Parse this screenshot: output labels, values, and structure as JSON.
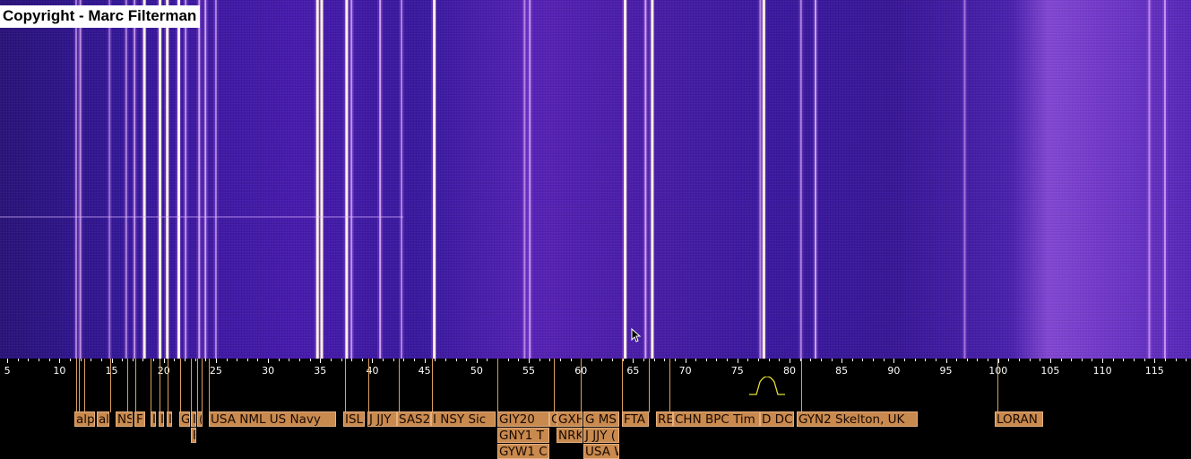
{
  "watermark": {
    "text": "Copyright - Marc Filterman"
  },
  "colors": {
    "background": "#000000",
    "label_bg": "#c98a4f",
    "label_text": "#1a0a00",
    "axis_text": "#ffffff",
    "filter_shape": "#e8e030"
  },
  "frequency_axis": {
    "unit": "kHz",
    "range": [
      4.3,
      118.5
    ],
    "major_ticks": [
      5,
      10,
      15,
      20,
      25,
      30,
      35,
      40,
      45,
      50,
      55,
      60,
      65,
      70,
      75,
      80,
      85,
      90,
      95,
      100,
      105,
      110,
      115
    ]
  },
  "signal_lines": [
    {
      "freq": 11.6,
      "brightness": 0.6
    },
    {
      "freq": 12.0,
      "brightness": 0.7
    },
    {
      "freq": 14.8,
      "brightness": 0.5
    },
    {
      "freq": 16.4,
      "brightness": 0.6
    },
    {
      "freq": 17.2,
      "brightness": 0.7
    },
    {
      "freq": 18.1,
      "brightness": 0.9
    },
    {
      "freq": 19.6,
      "brightness": 1.0
    },
    {
      "freq": 20.3,
      "brightness": 1.0
    },
    {
      "freq": 21.4,
      "brightness": 0.9
    },
    {
      "freq": 22.1,
      "brightness": 0.7
    },
    {
      "freq": 23.4,
      "brightness": 0.8
    },
    {
      "freq": 24.0,
      "brightness": 0.8
    },
    {
      "freq": 25.0,
      "brightness": 0.6
    },
    {
      "freq": 34.7,
      "brightness": 0.9
    },
    {
      "freq": 35.1,
      "brightness": 0.9
    },
    {
      "freq": 37.5,
      "brightness": 0.9
    },
    {
      "freq": 38.0,
      "brightness": 0.7
    },
    {
      "freq": 40.75,
      "brightness": 0.8
    },
    {
      "freq": 42.8,
      "brightness": 0.6
    },
    {
      "freq": 45.9,
      "brightness": 0.9
    },
    {
      "freq": 54.6,
      "brightness": 0.6
    },
    {
      "freq": 55.1,
      "brightness": 0.7
    },
    {
      "freq": 64.2,
      "brightness": 1.0
    },
    {
      "freq": 66.2,
      "brightness": 0.8
    },
    {
      "freq": 66.8,
      "brightness": 0.9
    },
    {
      "freq": 77.2,
      "brightness": 0.6
    },
    {
      "freq": 77.5,
      "brightness": 1.0
    },
    {
      "freq": 81.1,
      "brightness": 0.6
    },
    {
      "freq": 82.5,
      "brightness": 0.8
    },
    {
      "freq": 96.8,
      "brightness": 0.5
    },
    {
      "freq": 114.5,
      "brightness": 0.6
    },
    {
      "freq": 116.0,
      "brightness": 0.7
    }
  ],
  "stations": [
    {
      "label": "alp",
      "freq_left": 11.4,
      "width_khz": 2.0,
      "row": 0
    },
    {
      "label": "al",
      "freq_left": 13.6,
      "width_khz": 1.2,
      "row": 0
    },
    {
      "label": "NS",
      "freq_left": 15.4,
      "width_khz": 1.6,
      "row": 0
    },
    {
      "label": "F",
      "freq_left": 17.2,
      "width_khz": 1.0,
      "row": 0
    },
    {
      "label": "I",
      "freq_left": 18.7,
      "width_khz": 0.5,
      "row": 0
    },
    {
      "label": "I",
      "freq_left": 19.5,
      "width_khz": 0.5,
      "row": 0
    },
    {
      "label": "I",
      "freq_left": 20.3,
      "width_khz": 0.5,
      "row": 0
    },
    {
      "label": "G",
      "freq_left": 21.5,
      "width_khz": 1.0,
      "row": 0
    },
    {
      "label": "I",
      "freq_left": 22.6,
      "width_khz": 0.5,
      "row": 0
    },
    {
      "label": "F",
      "freq_left": 22.6,
      "width_khz": 0.5,
      "row": 1
    },
    {
      "label": "(",
      "freq_left": 23.2,
      "width_khz": 0.5,
      "row": 0
    },
    {
      "label": "USA NML US Navy",
      "freq_left": 24.3,
      "width_khz": 12.2,
      "row": 0
    },
    {
      "label": "ISL",
      "freq_left": 37.2,
      "width_khz": 2.1,
      "row": 0
    },
    {
      "label": "J JJY",
      "freq_left": 39.5,
      "width_khz": 2.8,
      "row": 0
    },
    {
      "label": "SAS2",
      "freq_left": 42.4,
      "width_khz": 3.3,
      "row": 0
    },
    {
      "label": "I NSY Sic",
      "freq_left": 45.6,
      "width_khz": 6.2,
      "row": 0
    },
    {
      "label": "GIY20",
      "freq_left": 52.0,
      "width_khz": 5.0,
      "row": 0
    },
    {
      "label": "GNY1 T",
      "freq_left": 52.0,
      "width_khz": 5.0,
      "row": 1
    },
    {
      "label": "GYW1 C",
      "freq_left": 52.0,
      "width_khz": 5.0,
      "row": 2
    },
    {
      "label": "C",
      "freq_left": 57.0,
      "width_khz": 0.8,
      "row": 0
    },
    {
      "label": "GXH",
      "freq_left": 57.7,
      "width_khz": 2.5,
      "row": 0
    },
    {
      "label": "NRK",
      "freq_left": 57.7,
      "width_khz": 2.5,
      "row": 1
    },
    {
      "label": "G MS",
      "freq_left": 60.2,
      "width_khz": 3.4,
      "row": 0
    },
    {
      "label": "J JJY (",
      "freq_left": 60.2,
      "width_khz": 3.4,
      "row": 1
    },
    {
      "label": "USA W",
      "freq_left": 60.2,
      "width_khz": 3.4,
      "row": 2
    },
    {
      "label": "FTA",
      "freq_left": 63.9,
      "width_khz": 2.6,
      "row": 0
    },
    {
      "label": "RE",
      "freq_left": 67.2,
      "width_khz": 1.6,
      "row": 0
    },
    {
      "label": "CHN BPC Tim",
      "freq_left": 68.8,
      "width_khz": 8.3,
      "row": 0
    },
    {
      "label": "D DC",
      "freq_left": 77.2,
      "width_khz": 3.3,
      "row": 0
    },
    {
      "label": "GYN2 Skelton, UK",
      "freq_left": 80.7,
      "width_khz": 11.6,
      "row": 0
    },
    {
      "label": "LORAN",
      "freq_left": 99.7,
      "width_khz": 4.6,
      "row": 0
    }
  ],
  "markers": [
    11.6,
    11.9,
    12.4,
    14.9,
    16.5,
    17.3,
    18.7,
    19.6,
    20.4,
    21.6,
    22.6,
    23.2,
    23.6,
    24.3,
    37.4,
    39.6,
    42.5,
    45.7,
    52.0,
    57.4,
    60.0,
    63.9,
    66.5,
    68.5,
    81.1,
    99.9
  ]
}
